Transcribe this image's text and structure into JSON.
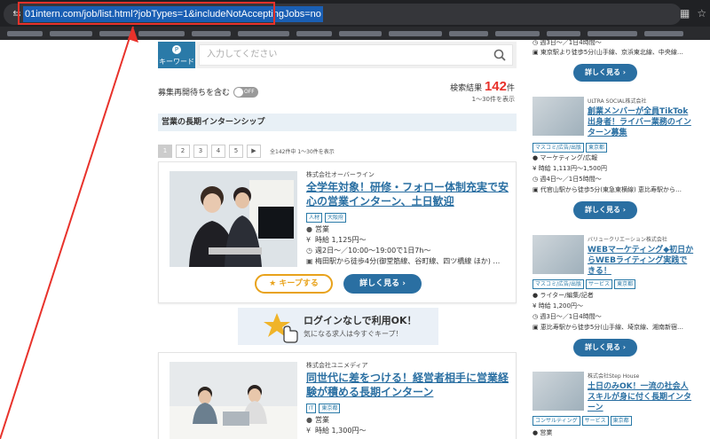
{
  "browser": {
    "url": "01intern.com/job/list.html?jobTypes=1&includeNotAcceptingJobs=no"
  },
  "search": {
    "keyword_label": "キーワード",
    "placeholder": "入力してください"
  },
  "filter": {
    "recruit_label": "募集再開待ちを含む",
    "toggle_state": "OFF"
  },
  "results": {
    "label": "検索結果",
    "count": "142",
    "unit": "件",
    "range": "1〜30件を表示"
  },
  "section_title": "営業の長期インターンシップ",
  "pagination": {
    "pages": [
      "1",
      "2",
      "3",
      "4",
      "5"
    ],
    "next": "▶",
    "info": "全142件中 1〜30件を表示"
  },
  "jobs": [
    {
      "company": "株式会社オーバーライン",
      "title": "全学年対象！研修・フォロー体制充実で安心の営業インターン、土日歓迎",
      "tags": [
        "人材",
        "大阪府"
      ],
      "category": "営業",
      "wage": "時給 1,125円〜",
      "schedule": "週2日〜／10:00〜19:00で1日7h〜",
      "access": "梅田駅から徒歩4分(御堂筋線、谷町線、四ツ橋線 ほか) …",
      "keep_label": "キープする",
      "detail_label": "詳しく見る"
    },
    {
      "company": "株式会社ユニメディア",
      "title": "同世代に差をつける！経営者相手に営業経験が積める長期インターン",
      "tags": [
        "IT",
        "東京都"
      ],
      "category": "営業",
      "wage": "時給 1,300円〜"
    }
  ],
  "login_banner": {
    "main": "ログインなしで利用OK！",
    "sub": "気になる求人は今すぐキープ！"
  },
  "sidebar": {
    "top_line1": "週3日〜／1日4時間〜",
    "top_line2": "東京駅より徒歩5分(山手線、京浜東北線、中央線…",
    "detail_label": "詳しく見る",
    "items": [
      {
        "company": "ULTRA SOCIAL株式会社",
        "title": "創業メンバーが全員TikTok出身者！ライバー業務のインターン募集",
        "tags": [
          "マスコミ/広告/出版",
          "東京都"
        ],
        "category": "マーケティング/広報",
        "wage": "時給 1,113円〜1,500円",
        "schedule": "週4日〜／1日5時間〜",
        "access": "代官山駅から徒歩5分(東急東横線) 恵比寿駅から…"
      },
      {
        "company": "バリュークリエーション株式会社",
        "title": "WEBマーケティング◆初日からWEBライティング実践できる！",
        "tags": [
          "マスコミ/広告/出版",
          "サービス",
          "東京都"
        ],
        "category": "ライター/編集/記者",
        "wage": "時給 1,200円〜",
        "schedule": "週3日〜／1日4時間〜",
        "access": "恵比寿駅から徒歩5分(山手線、埼京線、湘南新宿…"
      },
      {
        "company": "株式会社Step House",
        "title": "土日のみOK！一流の社会人スキルが身に付く長期インターン",
        "tags": [
          "コンサルティング",
          "サービス",
          "東京都"
        ],
        "category": "営業"
      }
    ]
  },
  "colors": {
    "brand_blue": "#2a6fa2",
    "accent_red": "#e8322b",
    "keep_orange": "#e8a21b"
  }
}
